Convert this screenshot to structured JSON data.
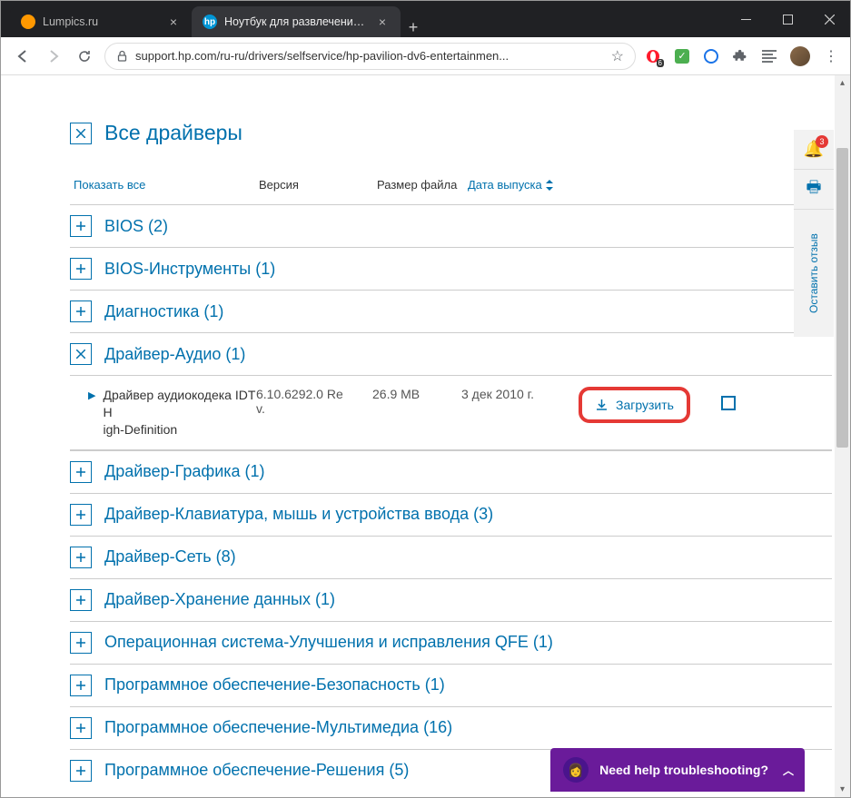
{
  "window": {
    "tabs": [
      {
        "title": "Lumpics.ru",
        "active": false
      },
      {
        "title": "Ноутбук для развлечений HP Pa",
        "active": true
      }
    ],
    "url": "support.hp.com/ru-ru/drivers/selfservice/hp-pavilion-dv6-entertainmen..."
  },
  "page": {
    "heading": "Все драйверы",
    "columns": {
      "show_all": "Показать все",
      "version": "Версия",
      "size": "Размер файла",
      "date": "Дата выпуска"
    },
    "categories": [
      {
        "label": "BIOS",
        "count": 2,
        "expanded": false
      },
      {
        "label": "BIOS-Инструменты",
        "count": 1,
        "expanded": false
      },
      {
        "label": "Диагностика",
        "count": 1,
        "expanded": false
      },
      {
        "label": "Драйвер-Аудио",
        "count": 1,
        "expanded": true
      },
      {
        "label": "Драйвер-Графика",
        "count": 1,
        "expanded": false
      },
      {
        "label": "Драйвер-Клавиатура, мышь и устройства ввода",
        "count": 3,
        "expanded": false
      },
      {
        "label": "Драйвер-Сеть",
        "count": 8,
        "expanded": false
      },
      {
        "label": "Драйвер-Хранение данных",
        "count": 1,
        "expanded": false
      },
      {
        "label": "Операционная система-Улучшения и исправления QFE",
        "count": 1,
        "expanded": false
      },
      {
        "label": "Программное обеспечение-Безопасность",
        "count": 1,
        "expanded": false
      },
      {
        "label": "Программное обеспечение-Мультимедиа",
        "count": 16,
        "expanded": false
      },
      {
        "label": "Программное обеспечение-Решения",
        "count": 5,
        "expanded": false
      }
    ],
    "driver": {
      "name": "Драйвер аудиокодека IDT High-Definition",
      "version": "6.10.6292.0 Rev.",
      "size": "26.9 MB",
      "date": "3 дек 2010 г.",
      "download_label": "Загрузить"
    }
  },
  "sidebar": {
    "notification_count": "3",
    "feedback_label": "Оставить отзыв"
  },
  "chat": {
    "label": "Need help troubleshooting?"
  }
}
